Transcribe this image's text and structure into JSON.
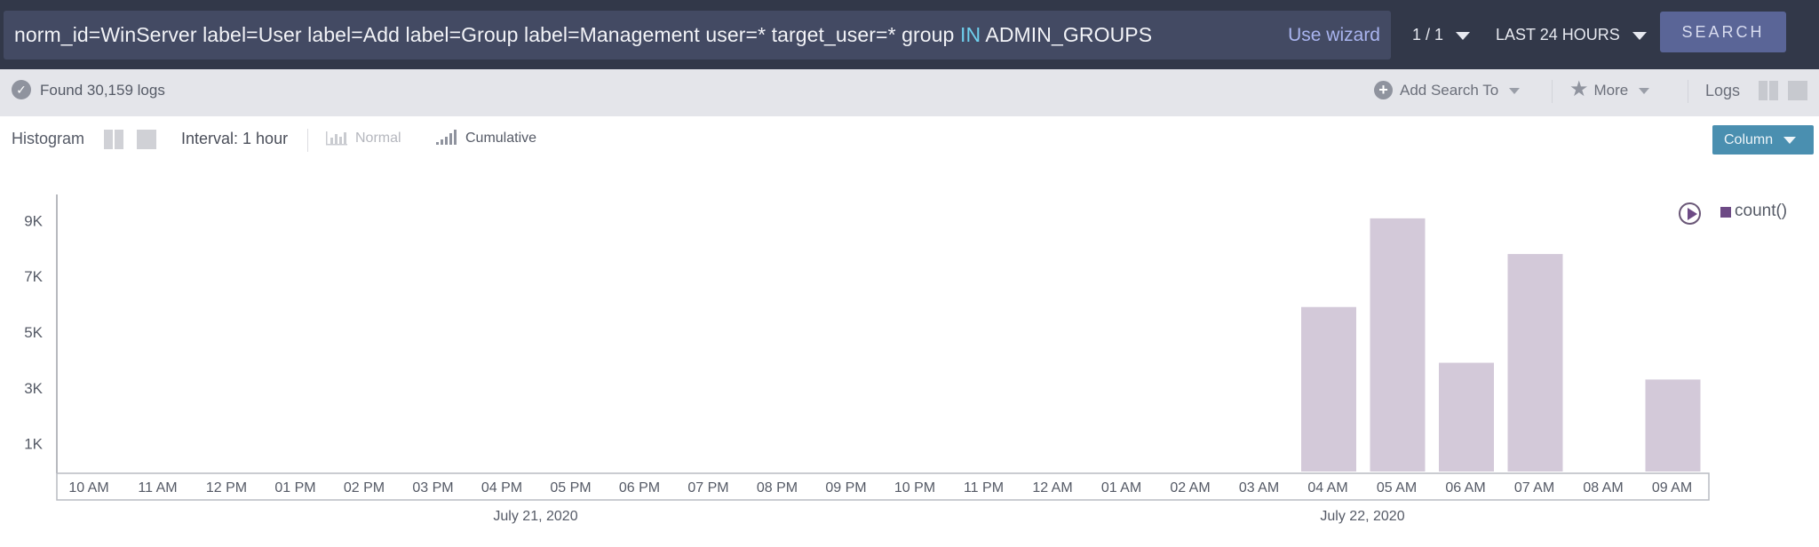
{
  "search": {
    "query_parts": [
      {
        "text": "norm_id=WinServer label=User label=Add label=Group label=Management user=* target_user=* group ",
        "keyword": false
      },
      {
        "text": "IN",
        "keyword": true
      },
      {
        "text": " ADMIN_GROUPS",
        "keyword": false
      }
    ],
    "use_wizard_label": "Use wizard",
    "page_selector": "1 / 1",
    "time_range": "LAST 24 HOURS",
    "search_label": "SEARCH"
  },
  "status": {
    "found_text": "Found 30,159 logs",
    "add_search_label": "Add Search To",
    "more_label": "More",
    "logs_label": "Logs"
  },
  "toolbar": {
    "histogram_label": "Histogram",
    "interval_label": "Interval: 1 hour",
    "normal_label": "Normal",
    "cumulative_label": "Cumulative",
    "column_label": "Column"
  },
  "colors": {
    "bar": "#d3c9d9",
    "legend_swatch": "#6d4a85",
    "topbar": "#323849",
    "search_button": "#5a6597",
    "column_button": "#4a8fb0"
  },
  "chart_data": {
    "type": "bar",
    "title": "",
    "xlabel": "",
    "ylabel": "",
    "categories": [
      "10 AM",
      "11 AM",
      "12 PM",
      "01 PM",
      "02 PM",
      "03 PM",
      "04 PM",
      "05 PM",
      "06 PM",
      "07 PM",
      "08 PM",
      "09 PM",
      "10 PM",
      "11 PM",
      "12 AM",
      "01 AM",
      "02 AM",
      "03 AM",
      "04 AM",
      "05 AM",
      "06 AM",
      "07 AM",
      "08 AM",
      "09 AM"
    ],
    "date_groups": [
      {
        "label": "July 21, 2020",
        "start_index": 0,
        "end_index": 13
      },
      {
        "label": "July 22, 2020",
        "start_index": 14,
        "end_index": 23
      }
    ],
    "series": [
      {
        "name": "count()",
        "values": [
          0,
          0,
          0,
          0,
          0,
          0,
          0,
          0,
          0,
          0,
          0,
          0,
          0,
          0,
          0,
          0,
          0,
          0,
          5900,
          9080,
          3900,
          7800,
          0,
          3300
        ]
      }
    ],
    "y_ticks": [
      {
        "value": 1000,
        "label": "1K"
      },
      {
        "value": 3000,
        "label": "3K"
      },
      {
        "value": 5000,
        "label": "5K"
      },
      {
        "value": 7000,
        "label": "7K"
      },
      {
        "value": 9000,
        "label": "9K"
      }
    ],
    "ylim": [
      0,
      10000
    ],
    "grid": false,
    "legend": {
      "entries": [
        "count()"
      ],
      "placement": "top-right"
    }
  }
}
